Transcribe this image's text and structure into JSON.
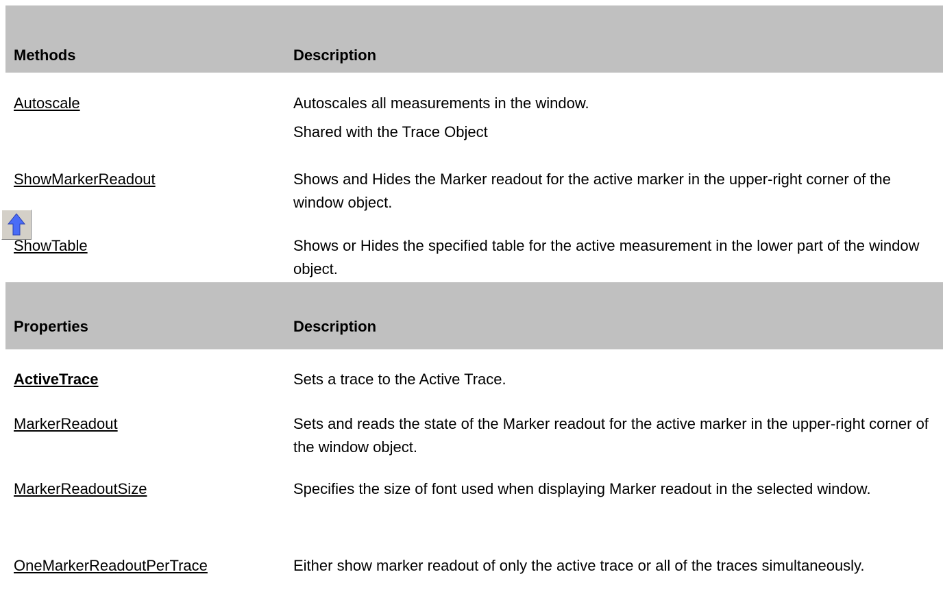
{
  "methods_header": {
    "col1": "Methods",
    "col2": "Description"
  },
  "methods": [
    {
      "name": "Autoscale",
      "desc": [
        "Autoscales all measurements in the window.",
        "Shared with the Trace Object"
      ]
    },
    {
      "name": "ShowMarkerReadout",
      "desc": [
        "Shows and Hides the Marker readout for the active marker in the upper-right corner of the window object."
      ]
    },
    {
      "name": "ShowTable",
      "desc": [
        "Shows or Hides the specified table for the active measurement in the lower part of the window object."
      ]
    }
  ],
  "properties_header": {
    "col1": "Properties",
    "col2": "Description"
  },
  "properties": [
    {
      "name": "ActiveTrace",
      "desc": "Sets a trace to the Active Trace."
    },
    {
      "name": "MarkerReadout",
      "desc": "Sets and reads the state of the Marker readout for the active marker in the upper-right corner of the window object."
    },
    {
      "name": "MarkerReadoutSize",
      "desc": "Specifies the size of font used when displaying Marker readout in the selected window."
    },
    {
      "name": "OneMarkerReadoutPerTrace",
      "desc": "Either show marker readout of only the active trace or all of the traces simultaneously."
    }
  ],
  "icons": {
    "back_to_top": "up-arrow-icon"
  },
  "colors": {
    "header_bg": "#c0c0c0",
    "arrow_fill": "#4a6cf7"
  }
}
